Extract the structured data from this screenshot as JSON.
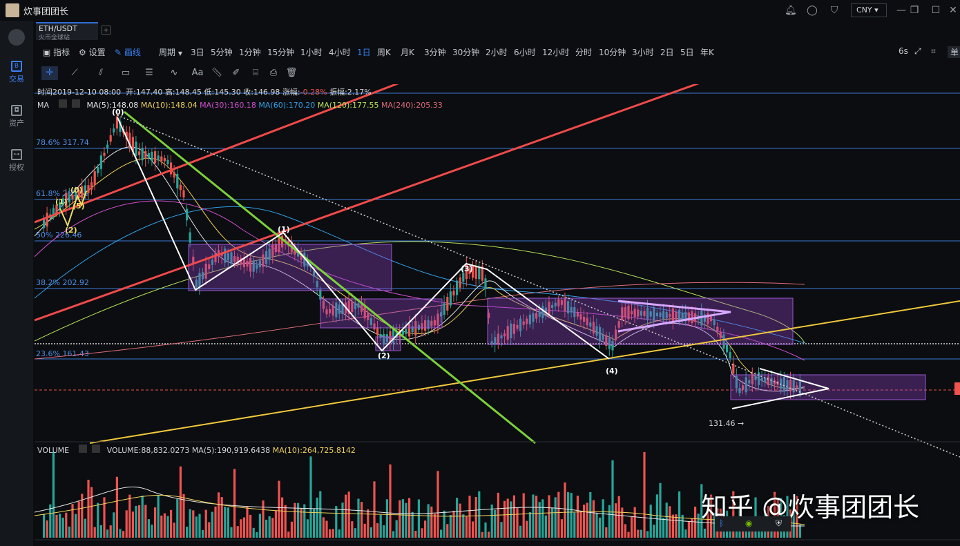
{
  "titlebar": {
    "app_title": "炊事团团长",
    "currency": "CNY ▾"
  },
  "sidebar": {
    "items": [
      {
        "label": "交易",
        "icon": "B"
      },
      {
        "label": "资产",
        "icon": "◘"
      },
      {
        "label": "授权",
        "icon": "⊶"
      }
    ]
  },
  "pair": {
    "name": "ETH/USDT",
    "sub": "火币全球站"
  },
  "toolbar": {
    "indicator": "指标",
    "settings": "设置",
    "draw": "画线",
    "period_label": "周期",
    "periods": [
      "3日",
      "5分钟",
      "1分钟",
      "15分钟",
      "1小时",
      "4小时",
      "1日",
      "周K",
      "月K",
      "3分钟",
      "30分钟",
      "2小时",
      "6小时",
      "12小时",
      "分时",
      "10分钟",
      "3小时",
      "2日",
      "5日",
      "年K"
    ],
    "active_period": "1日",
    "refresh": "6s",
    "single": "单"
  },
  "chart": {
    "info_line": {
      "time": "时间2019-12-10 08:00",
      "open": "开:147.40",
      "high": "高:148.45",
      "low": "低:145.30",
      "close": "收:146.98",
      "change_label": "涨幅:",
      "change": "-0.28%",
      "amplitude": "振幅:2.17%"
    },
    "ma_legend": {
      "name": "MA",
      "ma5": "MA(5):148.08",
      "ma10": "MA(10):148.04",
      "ma30": "MA(30):160.18",
      "ma60": "MA(60):170.20",
      "ma120": "MA(120):177.55",
      "ma240": "MA(240):205.33"
    },
    "fib_levels": [
      {
        "label": "78.6% 317.74"
      },
      {
        "label": "61.8% 265.59"
      },
      {
        "label": "50% 226.46"
      },
      {
        "label": "38.2% 202.92"
      },
      {
        "label": "23.6% 161.43"
      }
    ],
    "low_marker": "131.46",
    "wave_labels": [
      "(0)",
      "(1)",
      "(2)",
      "(0)",
      "(1)",
      "(2)",
      "(3)",
      "(4)",
      "(5)"
    ],
    "volume_legend": {
      "name": "VOLUME",
      "volume": "VOLUME:88,832.0273",
      "ma5": "MA(5):190,919.6438",
      "ma10": "MA(10):264,725.8142"
    }
  },
  "watermark": "知乎 @炊事团团长",
  "colors": {
    "up": "#26a69a",
    "down": "#ef5350",
    "accent": "#3b82f6",
    "fib_line": "#3e7bd6"
  }
}
